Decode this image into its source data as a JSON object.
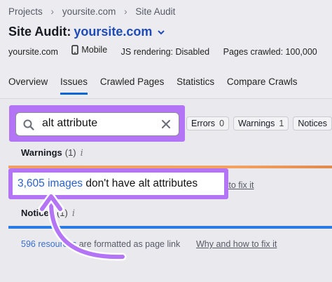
{
  "breadcrumb": [
    "Projects",
    "yoursite.com",
    "Site Audit"
  ],
  "header": {
    "title_prefix": "Site Audit:",
    "site": "yoursite.com"
  },
  "meta": {
    "domain": "yoursite.com",
    "device": "Mobile",
    "js_rendering": "JS rendering: Disabled",
    "pages_crawled": "Pages crawled: 100,000"
  },
  "tabs": [
    "Overview",
    "Issues",
    "Crawled Pages",
    "Statistics",
    "Compare Crawls"
  ],
  "active_tab": "Issues",
  "search": {
    "value": "alt attribute"
  },
  "filters": [
    {
      "label": "Errors",
      "count": "0"
    },
    {
      "label": "Warnings",
      "count": "1"
    },
    {
      "label": "Notices",
      "count": ""
    }
  ],
  "warnings": {
    "title": "Warnings",
    "count": "(1)"
  },
  "issue": {
    "count_link": "3,605 images",
    "text": " don't have alt attributes",
    "fix_link": "how to fix it"
  },
  "notices": {
    "title": "Notices",
    "count": "(1)"
  },
  "notice_row": {
    "count_link": "596 resources",
    "text": " are formatted as page link",
    "fix_link": "Why and how to fix it"
  },
  "colors": {
    "highlight": "#b374f5",
    "link": "#2a61c9",
    "warning_bar": "#f0a064",
    "notice_bar": "#2a7be4"
  }
}
